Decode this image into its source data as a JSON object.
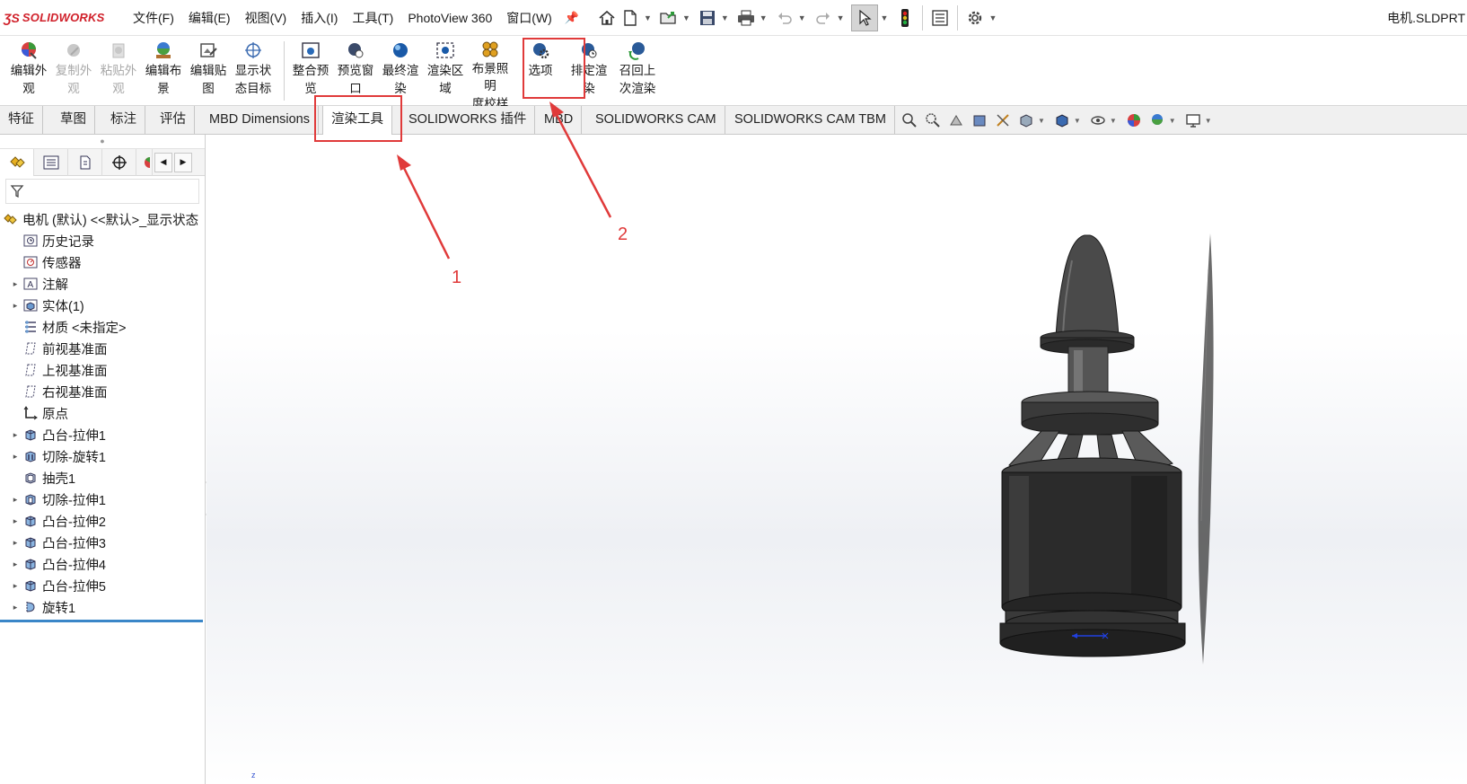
{
  "app": {
    "logo_ds": "ƷS",
    "logo_text": "SOLIDWORKS",
    "document_title": "电机.SLDPRT"
  },
  "menu": [
    "文件(F)",
    "编辑(E)",
    "视图(V)",
    "插入(I)",
    "工具(T)",
    "PhotoView 360",
    "窗口(W)"
  ],
  "quick_access": [
    "home-icon",
    "new-document-icon",
    "open-folder-icon",
    "save-icon",
    "print-icon",
    "undo-icon",
    "redo-icon",
    "select-pointer-icon",
    "rebuild-traffic-light-icon",
    "file-properties-icon",
    "options-gear-icon"
  ],
  "ribbon": {
    "buttons": [
      {
        "line1": "编辑外",
        "line2": "观",
        "enabled": true
      },
      {
        "line1": "复制外",
        "line2": "观",
        "enabled": false
      },
      {
        "line1": "粘贴外",
        "line2": "观",
        "enabled": false
      },
      {
        "line1": "编辑布",
        "line2": "景",
        "enabled": true
      },
      {
        "line1": "编辑贴",
        "line2": "图",
        "enabled": true
      },
      {
        "line1": "显示状",
        "line2": "态目标",
        "enabled": true
      },
      {
        "line1": "整合预",
        "line2": "览",
        "enabled": true
      },
      {
        "line1": "预览窗",
        "line2": "口",
        "enabled": true
      },
      {
        "line1": "最终渲",
        "line2": "染",
        "enabled": true
      },
      {
        "line1": "渲染区",
        "line2": "域",
        "enabled": true
      },
      {
        "line1": "布景照明",
        "line2": "度校样",
        "enabled": true
      },
      {
        "line1": "选项",
        "line2": "",
        "enabled": true
      },
      {
        "line1": "排定渲",
        "line2": "染",
        "enabled": true
      },
      {
        "line1": "召回上",
        "line2": "次渲染",
        "enabled": true
      }
    ]
  },
  "tabs": [
    "特征",
    "草图",
    "标注",
    "评估",
    "MBD Dimensions",
    "渲染工具",
    "SOLIDWORKS 插件",
    "MBD",
    "SOLIDWORKS CAM",
    "SOLIDWORKS CAM TBM"
  ],
  "active_tab": "渲染工具",
  "feature_tree": {
    "root": "电机 (默认) <<默认>_显示状态",
    "items": [
      {
        "label": "历史记录",
        "expandable": false
      },
      {
        "label": "传感器",
        "expandable": false
      },
      {
        "label": "注解",
        "expandable": true
      },
      {
        "label": "实体(1)",
        "expandable": true
      },
      {
        "label": "材质 <未指定>",
        "expandable": false
      },
      {
        "label": "前视基准面",
        "expandable": false
      },
      {
        "label": "上视基准面",
        "expandable": false
      },
      {
        "label": "右视基准面",
        "expandable": false
      },
      {
        "label": "原点",
        "expandable": false
      },
      {
        "label": "凸台-拉伸1",
        "expandable": true
      },
      {
        "label": "切除-旋转1",
        "expandable": true
      },
      {
        "label": "抽壳1",
        "expandable": false
      },
      {
        "label": "切除-拉伸1",
        "expandable": true
      },
      {
        "label": "凸台-拉伸2",
        "expandable": true
      },
      {
        "label": "凸台-拉伸3",
        "expandable": true
      },
      {
        "label": "凸台-拉伸4",
        "expandable": true
      },
      {
        "label": "凸台-拉伸5",
        "expandable": true
      },
      {
        "label": "旋转1",
        "expandable": true
      }
    ]
  },
  "annotations": {
    "label_1": "1",
    "label_2": "2",
    "highlight_color": "#e03a3a"
  },
  "triad_label": "z",
  "colors": {
    "accent_red": "#d0202a",
    "tree_end_bar": "#3a86c8",
    "model_body": "#2b2b2b"
  }
}
